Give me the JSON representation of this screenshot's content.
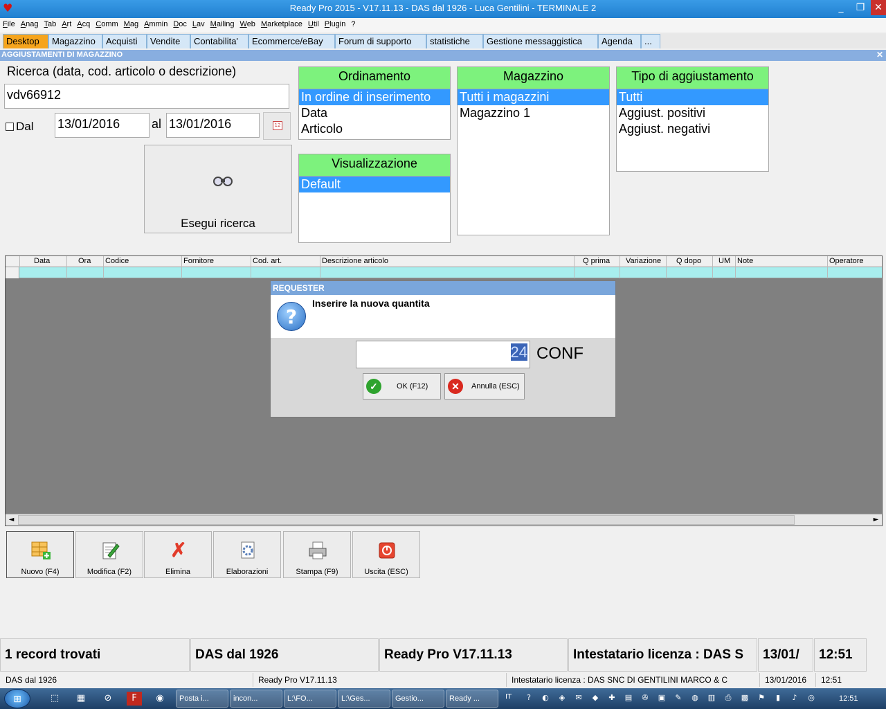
{
  "window": {
    "title": "Ready Pro 2015 - V17.11.13 - DAS dal 1926 - Luca Gentilini - TERMINALE 2",
    "min": "_",
    "max": "❐",
    "close": "✕"
  },
  "menu": [
    "File",
    "Anag",
    "Tab",
    "Art",
    "Acq",
    "Comm",
    "Mag",
    "Ammin",
    "Doc",
    "Lav",
    "Mailing",
    "Web",
    "Marketplace",
    "Util",
    "Plugin",
    "?"
  ],
  "tabs": [
    "Desktop",
    "Magazzino",
    "Acquisti",
    "Vendite",
    "Contabilita'",
    "Ecommerce/eBay",
    "Forum di supporto",
    "statistiche",
    "Gestione messaggistica",
    "Agenda",
    "..."
  ],
  "panel": {
    "title": "AGGIUSTAMENTI DI MAGAZZINO",
    "close": "✕"
  },
  "search": {
    "label": "Ricerca (data, cod. articolo o descrizione)",
    "value": "vdv66912",
    "dal_label": "Dal",
    "dal_checked": false,
    "date_from": "13/01/2016",
    "al_label": "al",
    "date_to": "13/01/2016",
    "calendar_text": "12",
    "run_label": "Esegui ricerca"
  },
  "ordinamento": {
    "title": "Ordinamento",
    "options": [
      "In ordine di inserimento",
      "Data",
      "Articolo"
    ],
    "selected": 0
  },
  "visualizzazione": {
    "title": "Visualizzazione",
    "options": [
      "Default"
    ],
    "selected": 0
  },
  "magazzino": {
    "title": "Magazzino",
    "options": [
      "Tutti i magazzini",
      "Magazzino 1"
    ],
    "selected": 0
  },
  "tipo": {
    "title": "Tipo di aggiustamento",
    "options": [
      "Tutti",
      "Aggiust. positivi",
      "Aggiust. negativi"
    ],
    "selected": 0
  },
  "grid": {
    "columns": [
      "Data",
      "Ora",
      "Codice",
      "Fornitore",
      "Cod. art.",
      "Descrizione articolo",
      "Q prima",
      "Variazione",
      "Q dopo",
      "UM",
      "Note",
      "Operatore"
    ],
    "scroll_left": "◄",
    "scroll_right": "►"
  },
  "dialog": {
    "title": "REQUESTER",
    "message": "Inserire la nuova quantita",
    "icon_glyph": "?",
    "value": "24",
    "unit": "CONF",
    "ok_label": "OK (F12)",
    "cancel_label": "Annulla (ESC)"
  },
  "toolbar": [
    {
      "label": "Nuovo (F4)",
      "icon": "new-grid-icon"
    },
    {
      "label": "Modifica (F2)",
      "icon": "edit-icon"
    },
    {
      "label": "Elimina",
      "icon": "delete-icon"
    },
    {
      "label": "Elaborazioni",
      "icon": "process-icon"
    },
    {
      "label": "Stampa (F9)",
      "icon": "print-icon"
    },
    {
      "label": "Uscita (ESC)",
      "icon": "exit-icon"
    }
  ],
  "status": {
    "records": "1 record trovati",
    "company": "DAS dal 1926",
    "version": "Ready Pro V17.11.13",
    "license_short": "Intestatario licenza : DAS S",
    "date_short": "13/01/",
    "time": "12:51",
    "company_small": "DAS dal 1926",
    "version_small": "Ready Pro V17.11.13",
    "license_full": "Intestatario licenza : DAS SNC DI GENTILINI MARCO & C",
    "date_small": "13/01/2016",
    "time_small": "12:51"
  },
  "taskbar": {
    "tasks": [
      "Posta i...",
      "incon...",
      "L:\\FO...",
      "L:\\Ges...",
      "Gestio...",
      "Ready ..."
    ],
    "lang": "IT",
    "clock": "12:51"
  },
  "colors": {
    "list_header": "#7df27d",
    "selected": "#3399ff",
    "active_tab": "#f6a41c",
    "grid_row": "#a8eeee"
  }
}
